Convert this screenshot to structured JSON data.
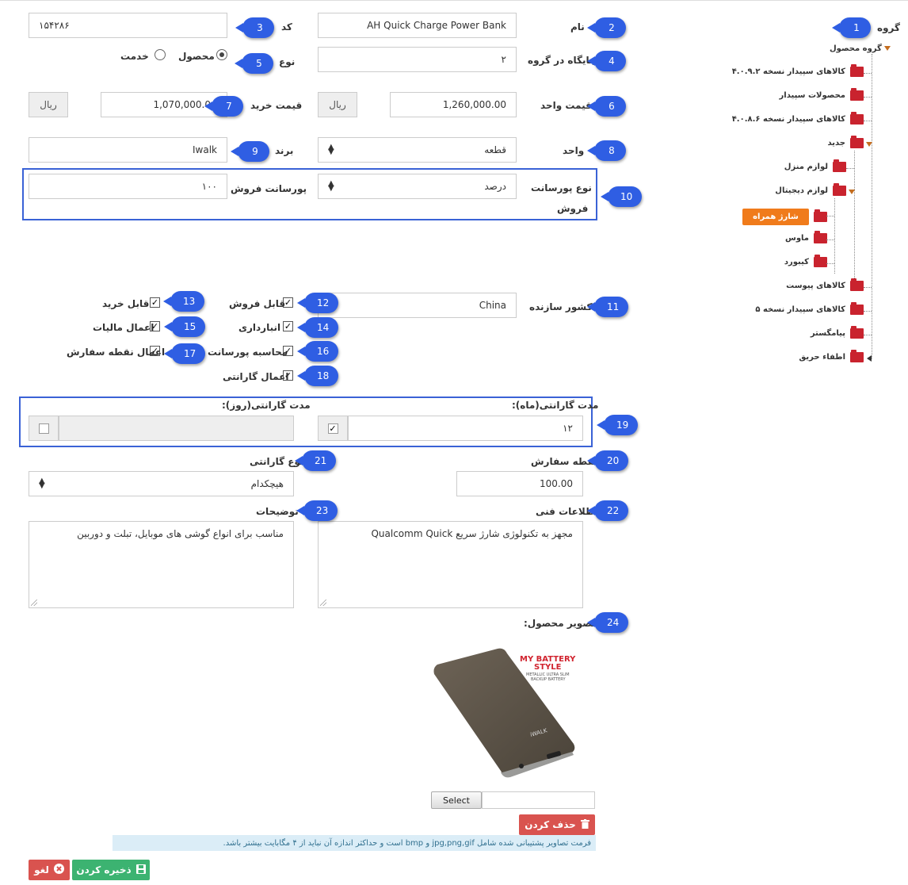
{
  "form": {
    "group_label": "گروه",
    "name_label": "نام",
    "name_value": "AH Quick Charge Power Bank",
    "code_label": "کد",
    "code_value": "۱۵۴۲۸۶",
    "position_label": "جایگاه در گروه",
    "position_value": "۲",
    "type_label": "نوع",
    "type_product": "محصول",
    "type_service": "خدمت",
    "unit_price_label": "قیمت واحد",
    "unit_price_value": "1,260,000.00",
    "buy_price_label": "قیمت خرید",
    "buy_price_value": "1,070,000.0",
    "currency": "ریال",
    "unit_label": "واحد",
    "unit_value": "قطعه",
    "brand_label": "برند",
    "brand_value": "Iwalk",
    "commission_type_label_line1": "نوع پورسانت",
    "commission_type_label_line2": "فروش",
    "commission_type_value": "درصد",
    "commission_label": "پورسانت فروش",
    "commission_value": "۱۰۰",
    "country_label": "کشور سازنده",
    "country_value": "China",
    "chk_sellable": "قابل فروش",
    "chk_purchasable": "قابل خرید",
    "chk_inventory": "انبارداری",
    "chk_tax": "اعمال مالیات",
    "chk_commission": "محاسبه پورسانت",
    "chk_reorder": "اعمال نقطه سفارش",
    "chk_warranty": "اعمال گارانتی",
    "warranty_month_label": "مدت گارانتی(ماه):",
    "warranty_month_value": "۱۲",
    "warranty_day_label": "مدت گارانتی(روز):",
    "reorder_label": "نقطه سفارش",
    "reorder_value": "100.00",
    "warranty_type_label": "نوع گارانتی",
    "warranty_type_value": "هیچکدام",
    "tech_label": "اطلاعات فنی",
    "tech_value": "مجهز به تکنولوژی شارژ سریع Qualcomm Quick",
    "desc_label": "توضیحات",
    "desc_value": "مناسب برای انواع گوشی های موبایل، تبلت و دوربین",
    "image_label": "تصویر محصول:",
    "select_button": "Select",
    "delete_button": "حذف کردن",
    "info_text": "فرمت تصاویر پشتیبانی شده شامل jpg,png,gif و bmp است و حداکثر اندازه آن نباید از ۴ مگابایت بیشتر باشد.",
    "save_button": "ذخیره کردن",
    "cancel_button": "لغو"
  },
  "product_image": {
    "brand_line1": "MY BATTERY",
    "brand_line2": "STYLE",
    "sub_line1": "METALLIC ULTRA SLIM",
    "sub_line2": "BACKUP BATTERY",
    "device_logo": "iWALK"
  },
  "tree": {
    "root": "گروه محصول",
    "items": [
      "کالاهای سپیدار نسخه ۴.۰.۹.۲",
      "محصولات سپیدار",
      "کالاهای سپیدار نسخه ۴.۰.۸.۶",
      "جدید",
      "لوازم منزل",
      "لوازم دیجیتال",
      "شارژ همراه",
      "ماوس",
      "کیبورد",
      "کالاهای پیوست",
      "کالاهای سپیدار نسخه ۵",
      "پیامگستر",
      "اطفاء حریق"
    ]
  },
  "badges": [
    "1",
    "2",
    "3",
    "4",
    "5",
    "6",
    "7",
    "8",
    "9",
    "10",
    "11",
    "12",
    "13",
    "14",
    "15",
    "16",
    "17",
    "18",
    "19",
    "20",
    "21",
    "22",
    "23",
    "24"
  ],
  "colors": {
    "badge": "#2f5ee3",
    "frame": "#3a62d6",
    "folder": "#c9232e",
    "selected": "#f07b1b",
    "delete": "#d9534f",
    "save": "#3cb371",
    "cancel": "#d9534f"
  }
}
